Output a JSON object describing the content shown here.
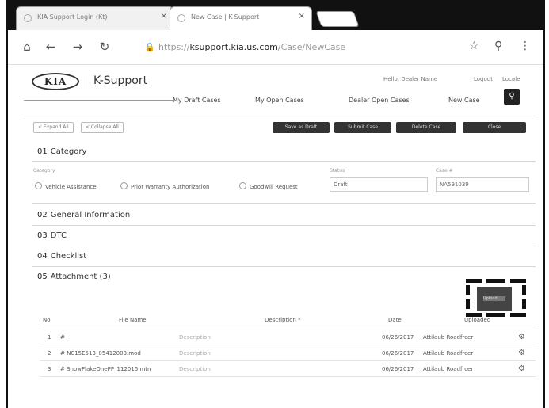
{
  "browser": {
    "tabs": [
      {
        "label": "KIA Support Login (Kt)"
      },
      {
        "label": "New Case | K-Support"
      }
    ],
    "url_prefix": "https://",
    "url_host": "ksupport.kia.us.com",
    "url_path": "/Case/NewCase"
  },
  "header": {
    "logo": "KIA",
    "title": "K-Support",
    "user_links": [
      "Hello, Dealer Name",
      "Logout",
      "Locale"
    ],
    "menu": [
      "My Draft Cases",
      "My Open Cases",
      "Dealer Open Cases",
      "New Case"
    ]
  },
  "actionbar": {
    "pills": [
      "< Expand All",
      "< Collapse All"
    ],
    "buttons": [
      "Save as Draft",
      "Submit Case",
      "Delete Case",
      "Close"
    ]
  },
  "sections": {
    "s1": {
      "num": "01",
      "title": "Category"
    },
    "s2": {
      "num": "02",
      "title": "General Information"
    },
    "s3": {
      "num": "03",
      "title": "DTC"
    },
    "s4": {
      "num": "04",
      "title": "Checklist"
    },
    "s5": {
      "num": "05",
      "title": "Attachment (3)"
    }
  },
  "category": {
    "label": "Category",
    "options": [
      "Vehicle Assistance",
      "Prior Warranty Authorization",
      "Goodwill Request"
    ],
    "field2_label": "Status",
    "field2_value": "Draft",
    "field3_label": "Case #",
    "field3_value": "NA591039"
  },
  "upload": {
    "label": "Upload"
  },
  "table": {
    "headers": [
      "No",
      "File Name",
      "Description *",
      "Date",
      "Uploaded"
    ],
    "rows": [
      {
        "no": "1",
        "file": "#",
        "desc": "Description",
        "date": "06/26/2017",
        "by": "Attilaub Roadfrcer"
      },
      {
        "no": "2",
        "file": "# NC15E513_05412003.mod",
        "desc": "Description",
        "date": "06/26/2017",
        "by": "Attilaub Roadfrcer"
      },
      {
        "no": "3",
        "file": "# SnowFlakeOnePP_112015.mtn",
        "desc": "Description",
        "date": "06/26/2017",
        "by": "Attilaub Roadfrcer"
      }
    ]
  }
}
